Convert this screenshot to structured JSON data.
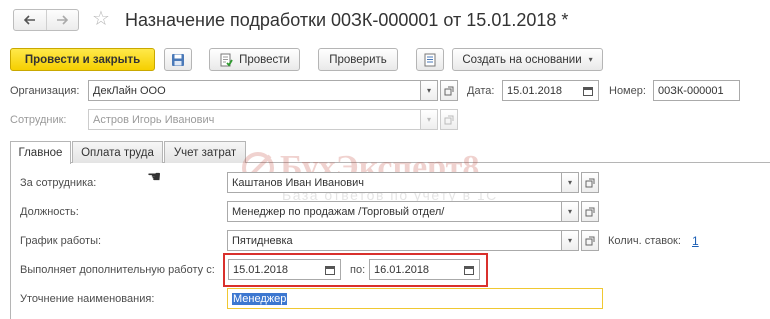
{
  "window": {
    "title": "Назначение подработки 00ЗК-000001 от 15.01.2018 *"
  },
  "toolbar": {
    "post_close": "Провести и закрыть",
    "post": "Провести",
    "check": "Проверить",
    "create_based": "Создать на основании"
  },
  "header": {
    "org_label": "Организация:",
    "org_value": "ДекЛайн ООО",
    "date_label": "Дата:",
    "date_value": "15.01.2018",
    "number_label": "Номер:",
    "number_value": "00ЗК-000001",
    "employee_label": "Сотрудник:",
    "employee_value": "Астров Игорь Иванович"
  },
  "tabs": [
    {
      "label": "Главное"
    },
    {
      "label": "Оплата труда"
    },
    {
      "label": "Учет затрат"
    }
  ],
  "main": {
    "for_employee_label": "За сотрудника:",
    "for_employee_value": "Каштанов Иван Иванович",
    "position_label": "Должность:",
    "position_value": "Менеджер по продажам /Торговый отдел/",
    "schedule_label": "График работы:",
    "schedule_value": "Пятидневка",
    "rates_label": "Колич. ставок:",
    "rates_value": "1",
    "extra_work_label": "Выполняет дополнительную работу с:",
    "extra_from": "15.01.2018",
    "extra_to_label": "по:",
    "extra_to": "16.01.2018",
    "name_clar_label": "Уточнение наименования:",
    "name_clar_value": "Менеджер"
  },
  "watermark": {
    "brand": "БухЭксперт8",
    "tagline": "База ответов по учёту в 1С"
  },
  "colors": {
    "primary_button": "#f5cf00",
    "highlight_border": "#d9302c",
    "selection": "#3c77d0",
    "watermark": "#c0392b"
  }
}
